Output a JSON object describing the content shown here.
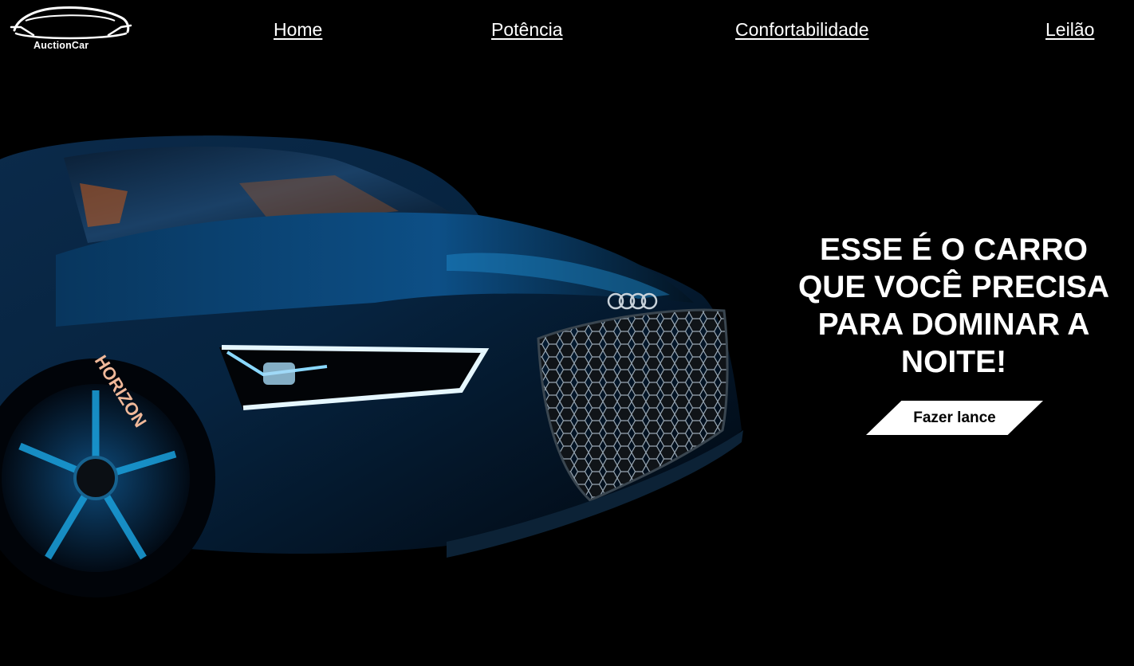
{
  "brand": {
    "logo_text": "AuctionCar"
  },
  "nav": {
    "items": [
      {
        "label": "Home"
      },
      {
        "label": "Potência"
      },
      {
        "label": "Confortabilidade"
      },
      {
        "label": "Leilão"
      }
    ]
  },
  "hero": {
    "headline": "ESSE É O CARRO QUE VOCÊ PRECISA PARA DOMINAR A NOITE!",
    "button_label": "Fazer lance",
    "tire_text": "HORIZON"
  },
  "colors": {
    "background": "#000000",
    "text": "#ffffff",
    "button_bg": "#ffffff",
    "button_text": "#000000",
    "car_accent": "#1ea3d8"
  }
}
